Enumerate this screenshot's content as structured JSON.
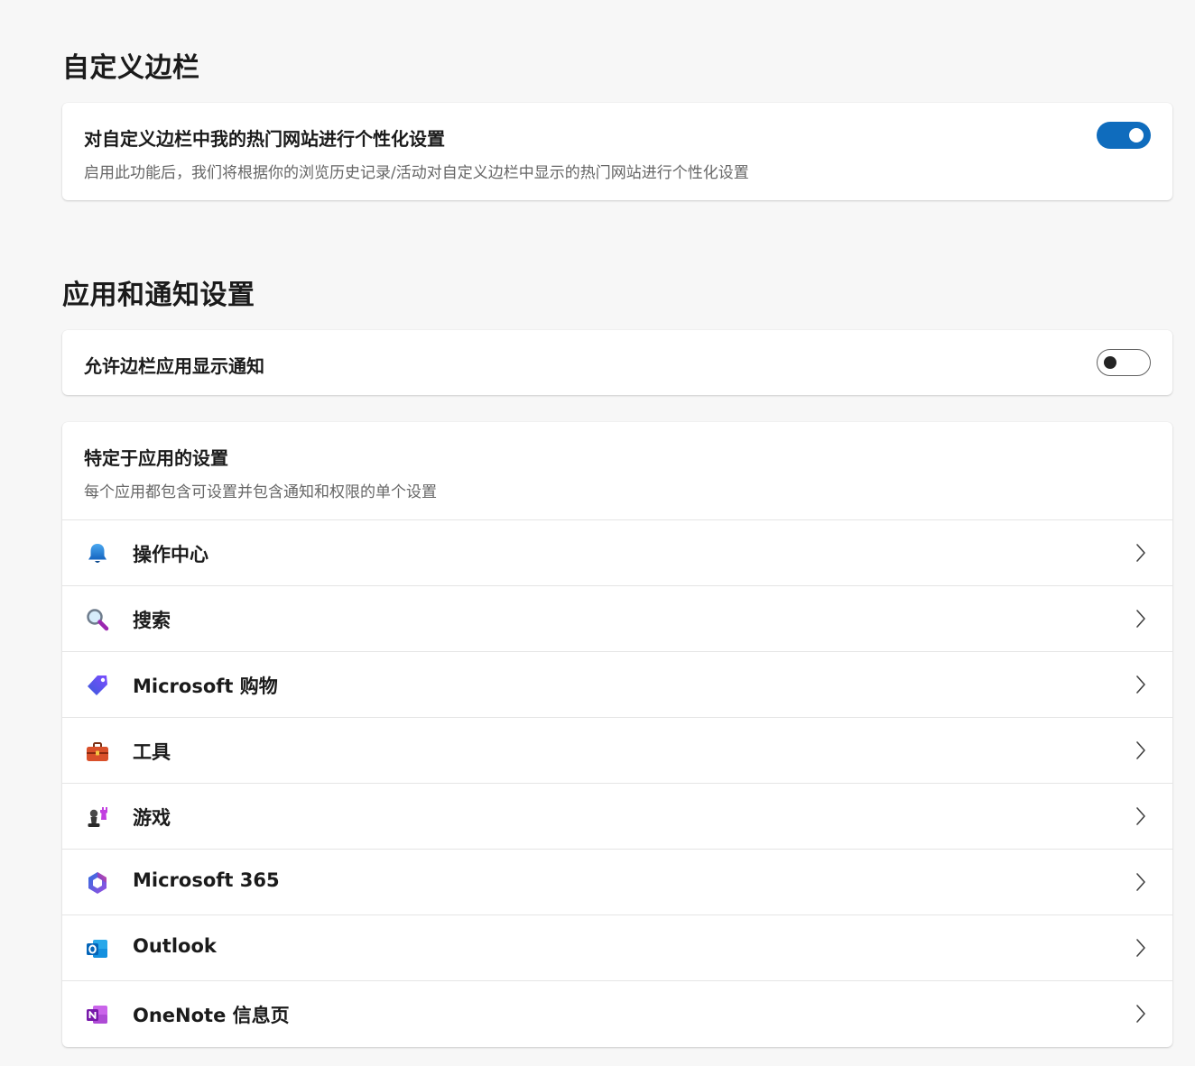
{
  "sections": {
    "sidebar_customize": {
      "title": "自定义边栏",
      "personalize": {
        "title": "对自定义边栏中我的热门网站进行个性化设置",
        "description": "启用此功能后，我们将根据你的浏览历史记录/活动对自定义边栏中显示的热门网站进行个性化设置",
        "enabled": true
      }
    },
    "app_notifications": {
      "title": "应用和通知设置",
      "allow_notifications": {
        "title": "允许边栏应用显示通知",
        "enabled": false
      },
      "app_specific": {
        "title": "特定于应用的设置",
        "description": "每个应用都包含可设置并包含通知和权限的单个设置",
        "apps": [
          {
            "label": "操作中心",
            "icon": "bell-icon"
          },
          {
            "label": "搜索",
            "icon": "magnifier-icon"
          },
          {
            "label": "Microsoft 购物",
            "icon": "shopping-tag-icon"
          },
          {
            "label": "工具",
            "icon": "toolbox-icon"
          },
          {
            "label": "游戏",
            "icon": "chess-games-icon"
          },
          {
            "label": "Microsoft 365",
            "icon": "microsoft-365-icon"
          },
          {
            "label": "Outlook",
            "icon": "outlook-icon"
          },
          {
            "label": "OneNote 信息页",
            "icon": "onenote-icon"
          }
        ]
      }
    }
  },
  "colors": {
    "accent": "#0f6cbd",
    "background": "#f7f7f7",
    "card": "#ffffff",
    "secondary_text": "#666666"
  }
}
